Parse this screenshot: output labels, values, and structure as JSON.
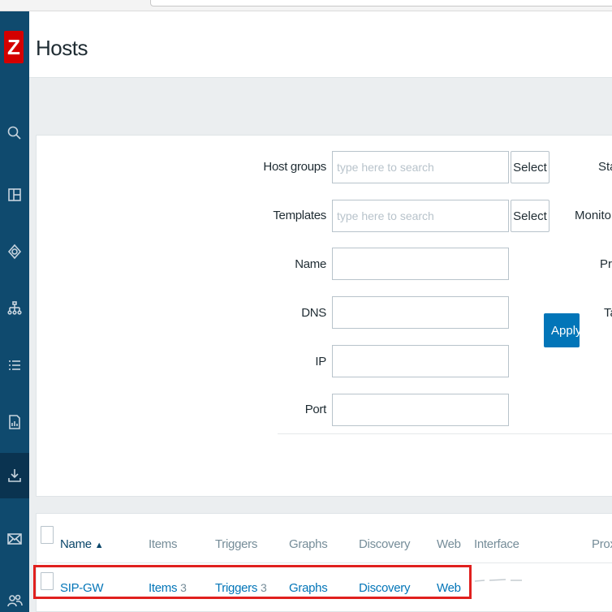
{
  "app": {
    "logo_letter": "Z",
    "page_title": "Hosts"
  },
  "sidebar": {
    "items": [
      {
        "icon": "search-icon"
      },
      {
        "icon": "dashboard-icon"
      },
      {
        "icon": "monitoring-eye-icon"
      },
      {
        "icon": "network-map-icon"
      },
      {
        "icon": "list-icon"
      },
      {
        "icon": "report-icon"
      },
      {
        "icon": "download-icon",
        "active": true
      },
      {
        "icon": "mail-icon"
      },
      {
        "icon": "users-icon"
      }
    ]
  },
  "filter": {
    "host_groups": {
      "label": "Host groups",
      "placeholder": "type here to search",
      "button": "Select"
    },
    "templates": {
      "label": "Templates",
      "placeholder": "type here to search",
      "button": "Select"
    },
    "name": {
      "label": "Name",
      "value": ""
    },
    "dns": {
      "label": "DNS",
      "value": ""
    },
    "ip": {
      "label": "IP",
      "value": ""
    },
    "port": {
      "label": "Port",
      "value": ""
    },
    "right_labels": {
      "status": "Stat",
      "monitored": "Monitored",
      "proxy": "Pro",
      "tags": "Ta"
    },
    "apply_label": "Apply"
  },
  "table": {
    "headers": {
      "name": "Name",
      "sort_indicator": "▲",
      "items": "Items",
      "triggers": "Triggers",
      "graphs": "Graphs",
      "discovery": "Discovery",
      "web": "Web",
      "interface": "Interface",
      "proxy": "Proxy"
    },
    "rows": [
      {
        "name": "SIP-GW",
        "items_label": "Items",
        "items_count": "3",
        "triggers_label": "Triggers",
        "triggers_count": "3",
        "graphs_label": "Graphs",
        "discovery_label": "Discovery",
        "web_label": "Web"
      }
    ]
  },
  "colors": {
    "sidebar": "#0f4a6e",
    "accent": "#0275b8",
    "highlight_border": "#e0201e",
    "logo": "#d40000"
  }
}
